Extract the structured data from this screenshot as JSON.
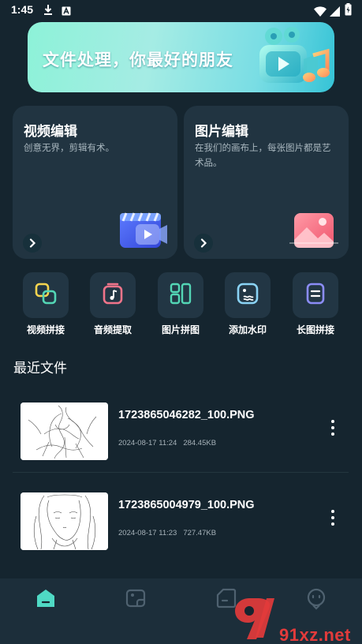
{
  "status_bar": {
    "time": "1:45",
    "left_icons": [
      "download-icon",
      "text-a-icon"
    ],
    "right_icons": [
      "wifi-icon",
      "signal-icon",
      "battery-icon"
    ]
  },
  "banner": {
    "text": "文件处理，你最好的朋友",
    "icon": "video-camera-music-icon"
  },
  "feature_cards": [
    {
      "title": "视频编辑",
      "desc": "创意无界，剪辑有术。",
      "icon": "clapperboard-icon"
    },
    {
      "title": "图片编辑",
      "desc": "在我们的画布上，每张图片都是艺术品。",
      "icon": "image-icon"
    }
  ],
  "tools": [
    {
      "label": "视频拼接",
      "icon": "video-stitch-icon",
      "color": "#f5d44f"
    },
    {
      "label": "音频提取",
      "icon": "music-note-icon",
      "color": "#f0748a"
    },
    {
      "label": "图片拼图",
      "icon": "collage-icon",
      "color": "#53d6b5"
    },
    {
      "label": "添加水印",
      "icon": "watermark-icon",
      "color": "#8ad3f5"
    },
    {
      "label": "长图拼接",
      "icon": "long-image-icon",
      "color": "#8b8cf7"
    }
  ],
  "recent": {
    "title": "最近文件",
    "files": [
      {
        "name": "1723865046282_100.PNG",
        "date": "2024-08-17 11:24",
        "size": "284.45KB"
      },
      {
        "name": "1723865004979_100.PNG",
        "date": "2024-08-17 11:23",
        "size": "727.47KB"
      }
    ]
  },
  "bottom_nav": {
    "items": [
      "home-icon",
      "gallery-icon",
      "files-icon",
      "profile-icon"
    ],
    "active_index": 0
  },
  "watermark": {
    "text": "91xz.net"
  },
  "colors": {
    "background": "#15252f",
    "card": "#213441",
    "accent": "#4fd9c4",
    "watermark": "#e23b3b"
  }
}
